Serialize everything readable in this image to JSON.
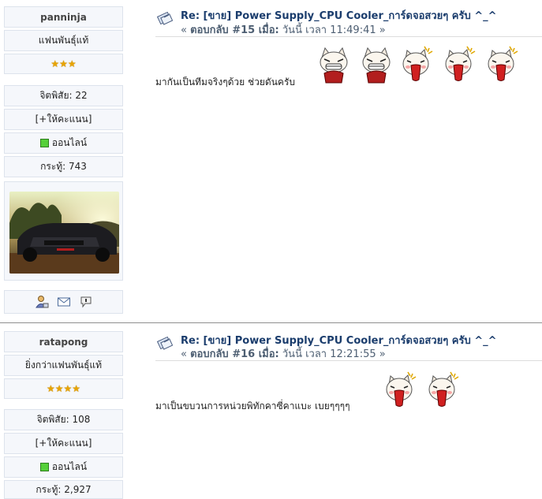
{
  "posts": [
    {
      "user": {
        "name": "panninja",
        "rank": "แฟนพันธุ์แท้",
        "stars": "★★★",
        "karma": "จิตพิสัย: 22",
        "karma_action": "[+ให้คะแนน]",
        "status": "ออนไลน์",
        "post_count": "กระทู้: 743"
      },
      "title": "Re: [ขาย] Power Supply_CPU Cooler_การ์ดจอสวยๆ ครับ ^_^",
      "meta_prefix": "« ",
      "meta_reply": "ตอบกลับ #15 เมื่อ:",
      "meta_time": " วันนี้ เวลา 11:49:41 »",
      "body": "มากันเป็นทีมจริงๆด้วย ช่วยดันครับ",
      "emotes": [
        "grin-cat-icon",
        "grin-cat-icon",
        "scream-cat-icon",
        "scream-cat-icon",
        "scream-cat-icon"
      ]
    },
    {
      "user": {
        "name": "ratapong",
        "rank": "ยิ่งกว่าแฟนพันธุ์แท้",
        "stars": "★★★★",
        "karma": "จิตพิสัย: 108",
        "karma_action": "[+ให้คะแนน]",
        "status": "ออนไลน์",
        "post_count": "กระทู้: 2,927"
      },
      "title": "Re: [ขาย] Power Supply_CPU Cooler_การ์ดจอสวยๆ ครับ ^_^",
      "meta_prefix": "« ",
      "meta_reply": "ตอบกลับ #16 เมื่อ:",
      "meta_time": " วันนี้ เวลา 12:21:55 »",
      "body": "มาเป็นขบวนการหน่วยพิทักคาซี่คาแบะ เบยๆๆๆๆ",
      "emotes": [
        "scream-cat-icon",
        "scream-cat-icon"
      ]
    }
  ],
  "profile_icons": [
    "profile-icon",
    "email-icon",
    "personal-message-icon"
  ],
  "colors": {
    "title": "#1b3d6d",
    "meta": "#4d5e72",
    "panel_bg": "#f5f7fb",
    "panel_border": "#dde3ec",
    "online": "#55d038"
  }
}
